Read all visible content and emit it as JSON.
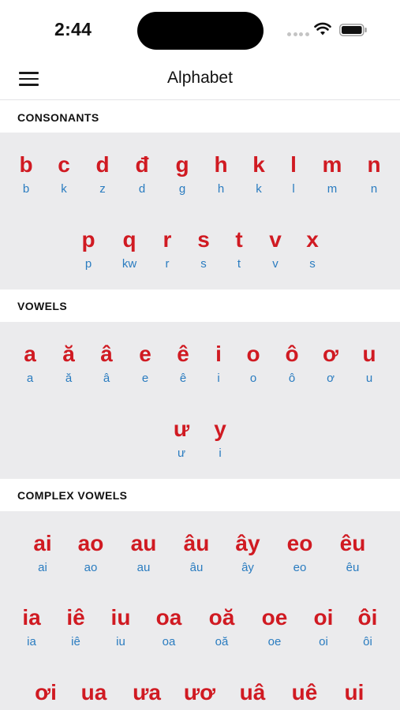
{
  "status_bar": {
    "time": "2:44"
  },
  "nav": {
    "title": "Alphabet"
  },
  "sections": {
    "consonants": {
      "title": "CONSONANTS",
      "rows": [
        [
          {
            "letter": "b",
            "sound": "b"
          },
          {
            "letter": "c",
            "sound": "k"
          },
          {
            "letter": "d",
            "sound": "z"
          },
          {
            "letter": "đ",
            "sound": "d"
          },
          {
            "letter": "g",
            "sound": "g"
          },
          {
            "letter": "h",
            "sound": "h"
          },
          {
            "letter": "k",
            "sound": "k"
          },
          {
            "letter": "l",
            "sound": "l"
          },
          {
            "letter": "m",
            "sound": "m"
          },
          {
            "letter": "n",
            "sound": "n"
          }
        ],
        [
          {
            "letter": "p",
            "sound": "p"
          },
          {
            "letter": "q",
            "sound": "kw"
          },
          {
            "letter": "r",
            "sound": "r"
          },
          {
            "letter": "s",
            "sound": "s"
          },
          {
            "letter": "t",
            "sound": "t"
          },
          {
            "letter": "v",
            "sound": "v"
          },
          {
            "letter": "x",
            "sound": "s"
          }
        ]
      ]
    },
    "vowels": {
      "title": "VOWELS",
      "rows": [
        [
          {
            "letter": "a",
            "sound": "a"
          },
          {
            "letter": "ă",
            "sound": "ă"
          },
          {
            "letter": "â",
            "sound": "â"
          },
          {
            "letter": "e",
            "sound": "e"
          },
          {
            "letter": "ê",
            "sound": "ê"
          },
          {
            "letter": "i",
            "sound": "i"
          },
          {
            "letter": "o",
            "sound": "o"
          },
          {
            "letter": "ô",
            "sound": "ô"
          },
          {
            "letter": "ơ",
            "sound": "ơ"
          },
          {
            "letter": "u",
            "sound": "u"
          }
        ],
        [
          {
            "letter": "ư",
            "sound": "ư"
          },
          {
            "letter": "y",
            "sound": "i"
          }
        ]
      ]
    },
    "complex_vowels": {
      "title": "COMPLEX VOWELS",
      "rows": [
        [
          {
            "letter": "ai",
            "sound": "ai"
          },
          {
            "letter": "ao",
            "sound": "ao"
          },
          {
            "letter": "au",
            "sound": "au"
          },
          {
            "letter": "âu",
            "sound": "âu"
          },
          {
            "letter": "ây",
            "sound": "ây"
          },
          {
            "letter": "eo",
            "sound": "eo"
          },
          {
            "letter": "êu",
            "sound": "êu"
          }
        ],
        [
          {
            "letter": "ia",
            "sound": "ia"
          },
          {
            "letter": "iê",
            "sound": "iê"
          },
          {
            "letter": "iu",
            "sound": "iu"
          },
          {
            "letter": "oa",
            "sound": "oa"
          },
          {
            "letter": "oă",
            "sound": "oă"
          },
          {
            "letter": "oe",
            "sound": "oe"
          },
          {
            "letter": "oi",
            "sound": "oi"
          },
          {
            "letter": "ôi",
            "sound": "ôi"
          }
        ],
        [
          {
            "letter": "ơi",
            "sound": ""
          },
          {
            "letter": "ua",
            "sound": ""
          },
          {
            "letter": "ưa",
            "sound": ""
          },
          {
            "letter": "ươ",
            "sound": ""
          },
          {
            "letter": "uâ",
            "sound": ""
          },
          {
            "letter": "uê",
            "sound": ""
          },
          {
            "letter": "ui",
            "sound": ""
          }
        ]
      ]
    }
  },
  "colors": {
    "letter": "#d01a22",
    "sound": "#2a7cc0",
    "section_bg": "#ebebed"
  }
}
